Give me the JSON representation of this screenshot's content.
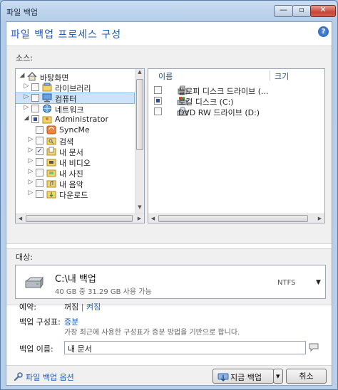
{
  "window": {
    "title": "파일 백업",
    "min_glyph": "—",
    "max_glyph": "▫",
    "close_glyph": "✕"
  },
  "header": {
    "title": "파일 백업 프로세스 구성",
    "help_glyph": "?"
  },
  "source": {
    "label": "소스:",
    "tree": [
      {
        "label": "바탕화면",
        "checkbox": false,
        "arrow": "◢",
        "icon": "home-icon"
      },
      {
        "label": "라이브러리",
        "checkbox": true,
        "checked": false,
        "arrow": "▷",
        "icon": "library-icon"
      },
      {
        "label": "컴퓨터",
        "checkbox": true,
        "checked": false,
        "arrow": "▷",
        "icon": "computer-icon",
        "selected": true
      },
      {
        "label": "네트워크",
        "checkbox": true,
        "checked": false,
        "arrow": "▷",
        "icon": "network-icon"
      },
      {
        "label": "Administrator",
        "checkbox": true,
        "checked": "partial",
        "arrow": "◢",
        "icon": "user-folder-icon"
      },
      {
        "label": "SyncMe",
        "checkbox": true,
        "checked": false,
        "arrow": "",
        "icon": "sync-icon"
      },
      {
        "label": "검색",
        "checkbox": true,
        "checked": false,
        "arrow": "▷",
        "icon": "search-folder-icon"
      },
      {
        "label": "내 문서",
        "checkbox": true,
        "checked": true,
        "arrow": "▷",
        "icon": "documents-icon"
      },
      {
        "label": "내 비디오",
        "checkbox": true,
        "checked": false,
        "arrow": "▷",
        "icon": "videos-icon"
      },
      {
        "label": "내 사진",
        "checkbox": true,
        "checked": false,
        "arrow": "▷",
        "icon": "pictures-icon"
      },
      {
        "label": "내 음악",
        "checkbox": true,
        "checked": false,
        "arrow": "▷",
        "icon": "music-icon"
      },
      {
        "label": "다운로드",
        "checkbox": true,
        "checked": false,
        "arrow": "▷",
        "icon": "downloads-icon"
      }
    ],
    "columns": {
      "name": "이름",
      "size": "크기"
    },
    "files": [
      {
        "label": "플로피 디스크 드라이브 (...",
        "checked": false,
        "icon": "floppy-icon"
      },
      {
        "label": "로컬 디스크 (C:)",
        "checked": "partial",
        "icon": "local-disk-icon"
      },
      {
        "label": "DVD RW 드라이브 (D:)",
        "checked": false,
        "icon": "dvd-icon"
      }
    ]
  },
  "destination": {
    "label": "대상:",
    "path": "C:\\내 백업",
    "info": "40 GB 중 31.29 GB 사용 가능",
    "fs": "NTFS",
    "drop_glyph": "▼"
  },
  "options": {
    "schedule_label": "예약:",
    "schedule_off": "꺼짐",
    "schedule_sep": " | ",
    "schedule_on": "켜짐",
    "scheme_label": "백업 구성표:",
    "scheme_value": "증분",
    "scheme_desc": "가장 최근에 사용한 구성표가 증분 방법을 기반으로 합니다.",
    "name_label": "백업 이름:",
    "name_value": "내 문서"
  },
  "footer": {
    "options_link": "파일 백업 옵션",
    "backup_now": "지금 백업",
    "backup_drop": "▾",
    "cancel": "취소"
  },
  "scroll": {
    "up": "▲",
    "down": "▼",
    "left": "◀",
    "right": "▶"
  }
}
